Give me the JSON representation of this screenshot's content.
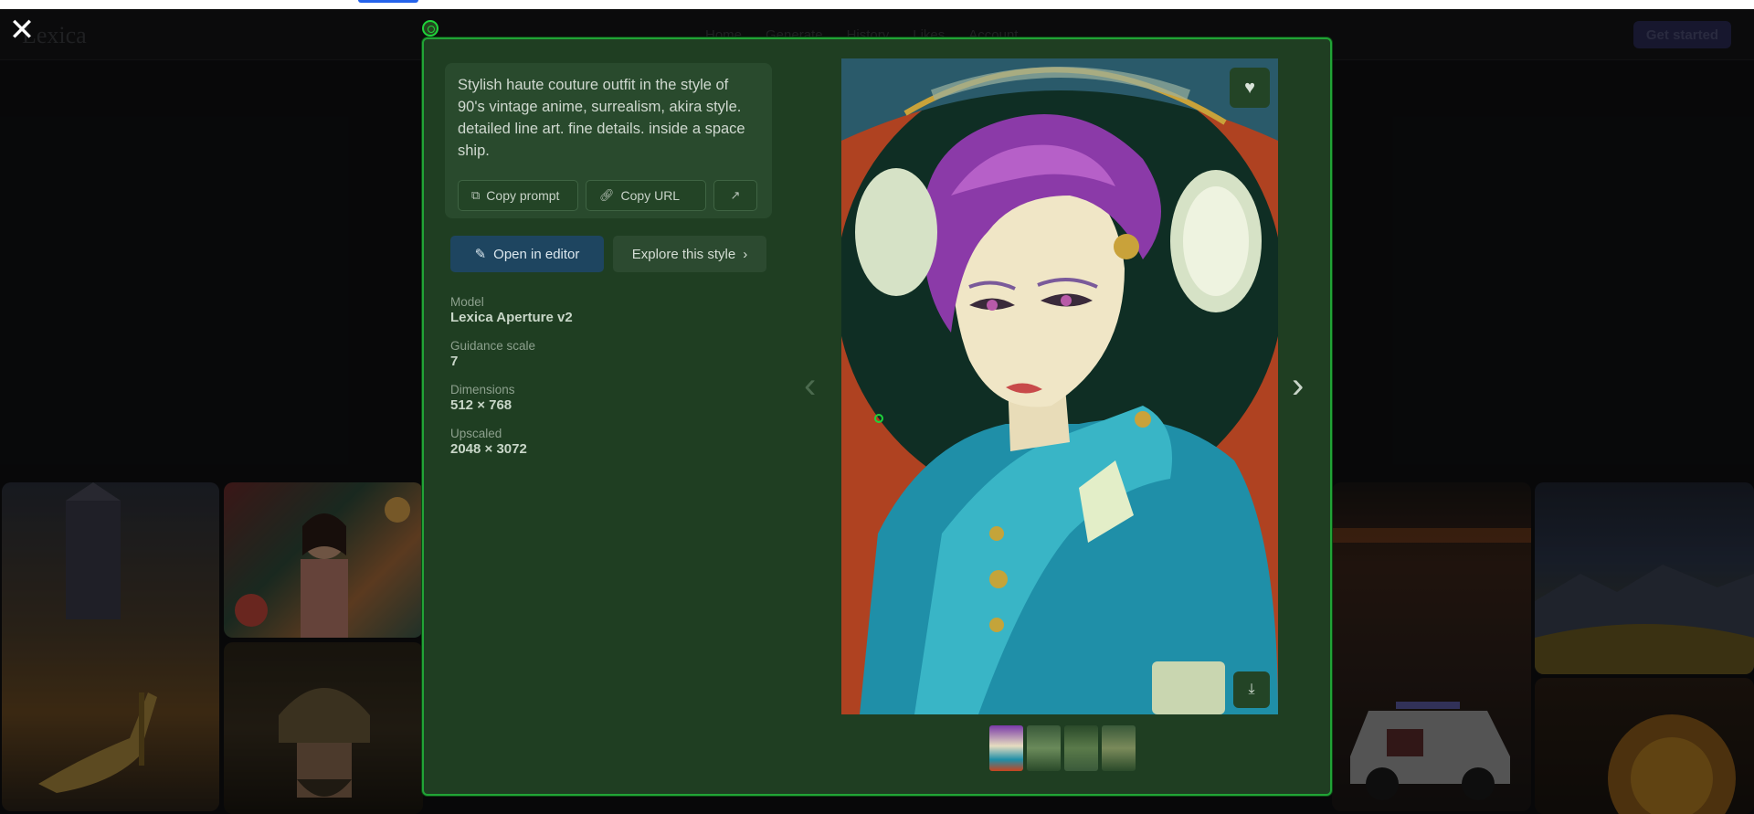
{
  "topbar": {
    "logo": "Lexica",
    "nav": [
      "Home",
      "Generate",
      "History",
      "Likes",
      "Account"
    ],
    "get_started": "Get started"
  },
  "modal": {
    "prompt": "Stylish haute couture outfit in the style of 90's vintage anime, surrealism, akira style. detailed line art. fine details. inside a space ship.",
    "copy_prompt": "Copy prompt",
    "copy_url": "Copy URL",
    "open_in_editor": "Open in editor",
    "explore_style": "Explore this style",
    "meta": [
      {
        "label": "Model",
        "value": "Lexica Aperture v2"
      },
      {
        "label": "Guidance scale",
        "value": "7"
      },
      {
        "label": "Dimensions",
        "value": "512 × 768"
      },
      {
        "label": "Upscaled",
        "value": "2048 × 3072"
      }
    ]
  },
  "icons": {
    "close": "close-icon",
    "copy": "copy-icon",
    "link": "link-icon",
    "external": "external-link-icon",
    "wand": "magic-wand-icon",
    "chevron": "chevron-right-icon",
    "heart": "heart-icon",
    "download": "download-icon",
    "prev": "chevron-left-icon",
    "next": "chevron-right-icon"
  },
  "colors": {
    "modal_bg": "#1f3e22",
    "modal_border": "#21a336",
    "editor_btn": "#1e4560"
  }
}
